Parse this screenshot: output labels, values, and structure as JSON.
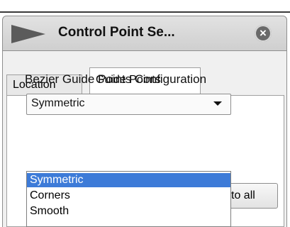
{
  "panel": {
    "title": "Control Point Se...",
    "close_icon": "close-icon"
  },
  "tabs": [
    {
      "label": "Location",
      "active": false
    },
    {
      "label": "Guide Points",
      "active": true
    }
  ],
  "config": {
    "label": "Bezier Guide Points Configuration",
    "selected": "Symmetric",
    "options": [
      "Symmetric",
      "Corners",
      "Smooth"
    ]
  },
  "apply_button": {
    "visible_label": "to all"
  },
  "colors": {
    "selection": "#3d7bd8",
    "header_bg": "#d8d8d8"
  }
}
